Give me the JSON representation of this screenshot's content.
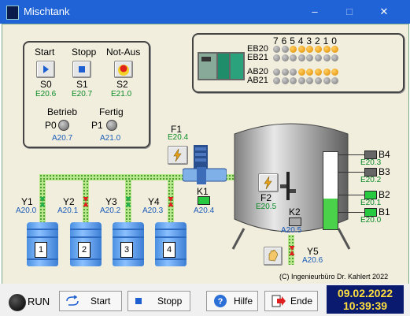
{
  "window": {
    "title": "Mischtank",
    "minimize": "–",
    "maximize": "□",
    "close": "✕"
  },
  "controls": {
    "start": {
      "label": "Start",
      "id": "S0",
      "addr": "E20.6"
    },
    "stopp": {
      "label": "Stopp",
      "id": "S1",
      "addr": "E20.7"
    },
    "notaus": {
      "label": "Not-Aus",
      "id": "S2",
      "addr": "E21.0"
    },
    "betrieb": {
      "label": "Betrieb",
      "id": "P0",
      "addr": "A20.7"
    },
    "fertig": {
      "label": "Fertig",
      "id": "P1",
      "addr": "A21.0"
    }
  },
  "io": {
    "bits": [
      "7",
      "6",
      "5",
      "4",
      "3",
      "2",
      "1",
      "0"
    ],
    "rows": [
      {
        "label": "EB20",
        "states": [
          0,
          0,
          1,
          1,
          1,
          1,
          1,
          1
        ]
      },
      {
        "label": "EB21",
        "states": [
          0,
          0,
          0,
          0,
          0,
          0,
          0,
          0
        ]
      },
      {
        "label": "AB20",
        "states": [
          0,
          0,
          0,
          1,
          1,
          1,
          1,
          1
        ]
      },
      {
        "label": "AB21",
        "states": [
          0,
          0,
          0,
          0,
          0,
          0,
          0,
          0
        ]
      }
    ],
    "colors": {
      "on": "#f59a00",
      "off": "#888888"
    }
  },
  "process": {
    "f1": {
      "label": "F1",
      "addr": "E20.4"
    },
    "k1": {
      "label": "K1",
      "addr": "A20.4"
    },
    "f2": {
      "label": "F2",
      "addr": "E20.5"
    },
    "k2": {
      "label": "K2",
      "addr": "A20.5"
    },
    "y5": {
      "label": "Y5",
      "addr": "A20.6"
    },
    "valves": [
      {
        "label": "Y1",
        "addr": "A20.0",
        "state": "open"
      },
      {
        "label": "Y2",
        "addr": "A20.1",
        "state": "closed"
      },
      {
        "label": "Y3",
        "addr": "A20.2",
        "state": "open"
      },
      {
        "label": "Y4",
        "addr": "A20.3",
        "state": "closed"
      }
    ],
    "tanks": [
      "1",
      "2",
      "3",
      "4"
    ],
    "sensors": [
      {
        "label": "B4",
        "addr": "E20.3",
        "active": false
      },
      {
        "label": "B3",
        "addr": "E20.2",
        "active": false
      },
      {
        "label": "B2",
        "addr": "E20.1",
        "active": true
      },
      {
        "label": "B1",
        "addr": "E20.0",
        "active": true
      }
    ],
    "level_fraction": 0.4,
    "copyright": "(C) Ingenieurbüro Dr. Kahlert 2022"
  },
  "statusbar": {
    "run": "RUN",
    "start": "Start",
    "stopp": "Stopp",
    "hilfe": "Hilfe",
    "ende": "Ende",
    "date": "09.02.2022",
    "time": "10:39:39"
  }
}
